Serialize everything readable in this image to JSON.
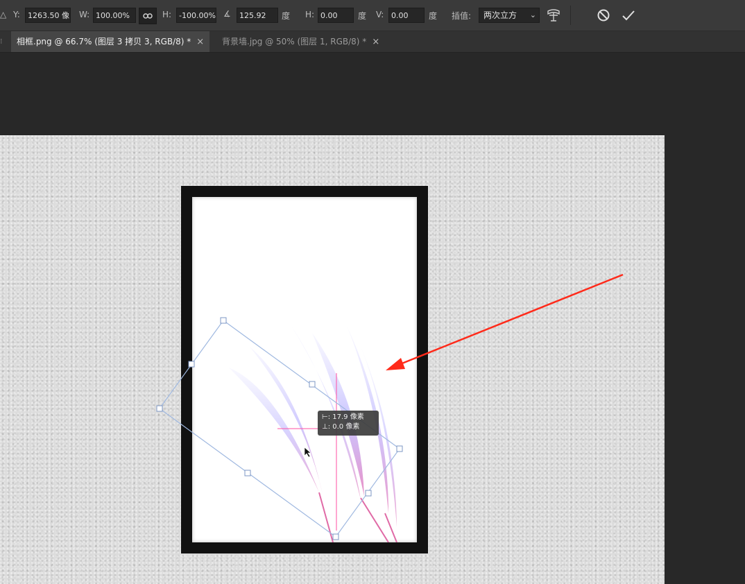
{
  "options": {
    "y_label": "Y:",
    "y_value": "1263.50 像",
    "w_label": "W:",
    "w_value": "100.00%",
    "h_label": "H:",
    "h_value": "-100.00%",
    "angle_value": "125.92",
    "angle_unit": "度",
    "hskew_label": "H:",
    "hskew_value": "0.00",
    "hskew_unit": "度",
    "vskew_label": "V:",
    "vskew_value": "0.00",
    "vskew_unit": "度",
    "interp_label": "插值:",
    "interp_value": "两次立方"
  },
  "tabs": [
    {
      "label": "相框.png @ 66.7% (图层 3 拷贝 3, RGB/8) *",
      "close": "×"
    },
    {
      "label": "背景墙.jpg @ 50% (图层 1, RGB/8) *",
      "close": "×"
    }
  ],
  "hud": {
    "line1": "⊢: 17.9 像素",
    "line2": "⊥:   0.0 像素"
  },
  "colors": {
    "accent_arrow": "#ff2a1a",
    "transform_box": "#9fb8e0"
  }
}
